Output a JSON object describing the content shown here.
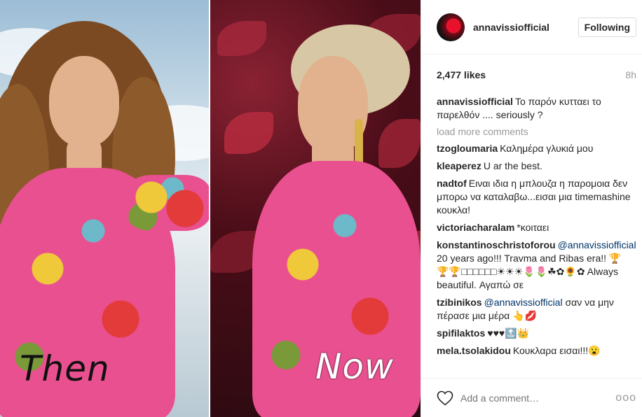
{
  "photo": {
    "left_caption": "Then",
    "right_caption": "Now"
  },
  "header": {
    "username": "annavissiofficial",
    "follow_label": "Following"
  },
  "post": {
    "likes": "2,477 likes",
    "time": "8h"
  },
  "caption": {
    "user": "annavissiofficial",
    "text": "Το παρόν κυτταει το παρελθόν .... seriously ?"
  },
  "load_more": "load more comments",
  "comments": [
    {
      "user": "tzogloumaria",
      "text": "Καλημέρα γλυκιά μου"
    },
    {
      "user": "kleaperez",
      "text": "U ar the best."
    },
    {
      "user": "nadtof",
      "text": "Ειναι ιδια η μπλουζα η παρομοια δεν μπορω να καταλαβω...εισαι μια timemashine κουκλα!"
    },
    {
      "user": "victoriacharalam",
      "text": "*κοιταει"
    },
    {
      "user": "konstantinoschristoforou",
      "mention": "@annavissiofficial",
      "text": " 20 years ago!!! Travma and Ribas era!! 🏆🏆🏆□□□□□□☀☀☀🌷🌷☘✿🌻✿ Always beautiful. Αγαπώ σε"
    },
    {
      "user": "tzibinikos",
      "mention": "@annavissiofficial",
      "text": " σαν να μην πέρασε μια μέρα 👆💋"
    },
    {
      "user": "spifilaktos",
      "text": "♥♥♥🔝👑"
    },
    {
      "user": "mela.tsolakidou",
      "text": "Κουκλαρα εισαι!!!😮"
    }
  ],
  "add_comment": {
    "placeholder": "Add a comment…",
    "more": "ooo"
  },
  "colors": {
    "mention": "#003569",
    "muted": "#999999"
  }
}
